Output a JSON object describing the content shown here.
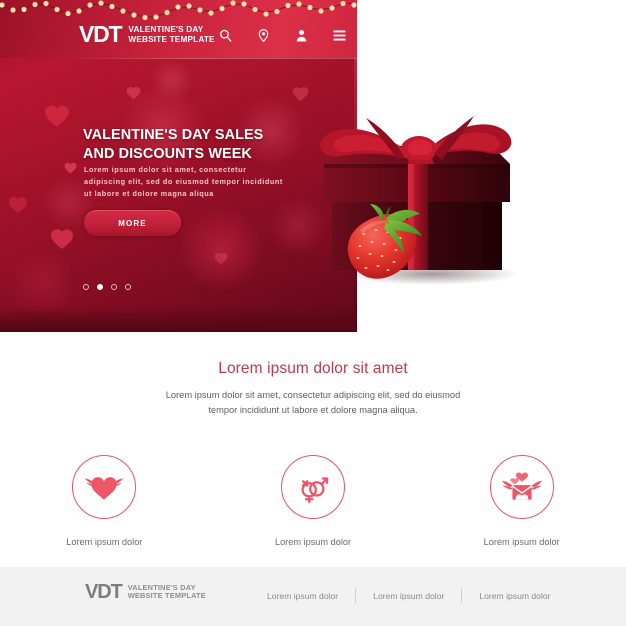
{
  "header": {
    "logo_mark": "VDT",
    "logo_line1": "VALENTINE'S DAY",
    "logo_line2": "WEBSITE TEMPLATE",
    "icons": [
      "search-icon",
      "location-pin-icon",
      "user-icon",
      "menu-icon"
    ]
  },
  "hero": {
    "title_line1": "VALENTINE'S DAY SALES",
    "title_line2": "AND DISCOUNTS WEEK",
    "description": "Lorem ipsum dolor sit amet, consectetur adipiscing elit, sed do eiusmod tempor incididunt ut labore et dolore magna aliqua",
    "button_label": "MORE",
    "slider_dots": 4,
    "slider_active_index": 1,
    "image": "gift-box-with-strawberry"
  },
  "main": {
    "title": "Lorem ipsum dolor sit amet",
    "description": "Lorem ipsum dolor sit amet, consectetur adipiscing elit, sed do eiusmod tempor incididunt ut labore et dolore magna aliqua.",
    "features": [
      {
        "icon": "winged-heart-icon",
        "label": "Lorem ipsum dolor"
      },
      {
        "icon": "gender-symbols-icon",
        "label": "Lorem ipsum dolor"
      },
      {
        "icon": "winged-love-envelope-icon",
        "label": "Lorem ipsum dolor"
      }
    ]
  },
  "footer": {
    "logo_mark": "VDT",
    "logo_line1": "VALENTINE'S DAY",
    "logo_line2": "WEBSITE TEMPLATE",
    "links": [
      "Lorem ipsum dolor",
      "Lorem ipsum dolor",
      "Lorem ipsum dolor"
    ]
  },
  "colors": {
    "hero_red": "#9e1128",
    "header_red": "#c8223c",
    "accent_pink": "#e2566a",
    "title_red": "#c0394a",
    "footer_bg": "#f2f2f2",
    "text_gray": "#6b6b6b",
    "light_bulb": "#ffe2a0"
  }
}
